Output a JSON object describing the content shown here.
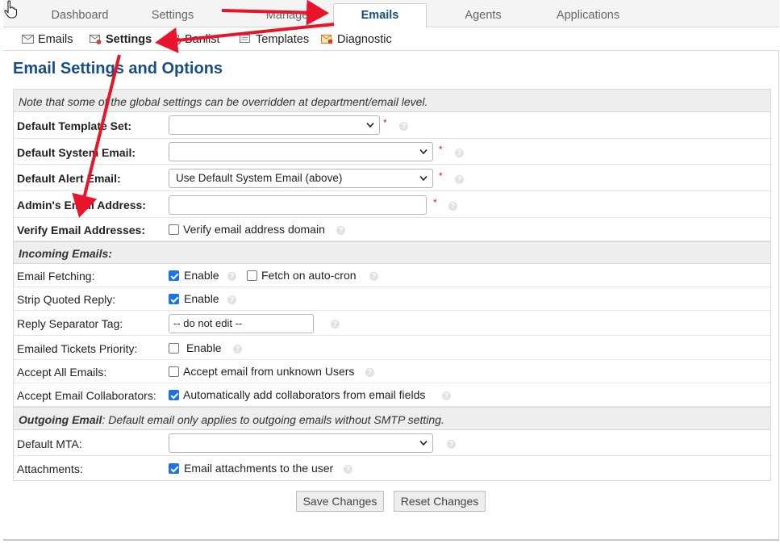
{
  "tabs": [
    {
      "label": "Dashboard"
    },
    {
      "label": "Settings"
    },
    {
      "label": "Manage"
    },
    {
      "label": "Emails"
    },
    {
      "label": "Agents"
    },
    {
      "label": "Applications"
    }
  ],
  "subnav": [
    {
      "label": "Emails",
      "icon": "envelope-icon"
    },
    {
      "label": "Settings",
      "icon": "email-settings-icon"
    },
    {
      "label": "Banlist",
      "icon": "banlist-icon"
    },
    {
      "label": "Templates",
      "icon": "templates-icon"
    },
    {
      "label": "Diagnostic",
      "icon": "diagnostic-icon"
    }
  ],
  "page_title": "Email Settings and Options",
  "note": "Note that some of the global settings can be overridden at department/email level.",
  "fields": {
    "template_set": {
      "label": "Default Template Set:",
      "value": ""
    },
    "system_email": {
      "label": "Default System Email:",
      "value": ""
    },
    "alert_email": {
      "label": "Default Alert Email:",
      "value": "Use Default System Email (above)"
    },
    "admin_email": {
      "label": "Admin's Email Address:",
      "value": ""
    },
    "verify": {
      "label": "Verify Email Addresses:",
      "option": "Verify email address domain",
      "checked": false
    }
  },
  "incoming": {
    "heading": "Incoming Emails:",
    "fetching": {
      "label": "Email Fetching:",
      "enable": "Enable",
      "enable_checked": true,
      "autocron": "Fetch on auto-cron",
      "autocron_checked": false
    },
    "strip_quoted": {
      "label": "Strip Quoted Reply:",
      "enable": "Enable",
      "checked": true
    },
    "separator": {
      "label": "Reply Separator Tag:",
      "value": "-- do not edit --"
    },
    "priority": {
      "label": "Emailed Tickets Priority:",
      "enable": "Enable",
      "checked": false
    },
    "accept_all": {
      "label": "Accept All Emails:",
      "option": "Accept email from unknown Users",
      "checked": false
    },
    "collaborators": {
      "label": "Accept Email Collaborators:",
      "option": "Automatically add collaborators from email fields",
      "checked": true
    }
  },
  "outgoing": {
    "heading": "Outgoing Email",
    "heading_note": ": Default email only applies to outgoing emails without SMTP setting.",
    "mta": {
      "label": "Default MTA:",
      "value": ""
    },
    "attachments": {
      "label": "Attachments:",
      "option": "Email attachments to the user",
      "checked": true
    }
  },
  "buttons": {
    "save": "Save Changes",
    "reset": "Reset Changes"
  },
  "required_mark": "*",
  "colors": {
    "accent": "#184e81",
    "annotation_arrow": "#e8142c",
    "checkbox": "#1a73e8"
  }
}
